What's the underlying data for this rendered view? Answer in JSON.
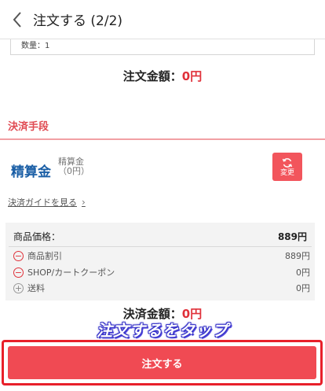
{
  "header": {
    "title": "注文する (2/2)",
    "back_icon": "chevron-left-icon"
  },
  "item": {
    "quantity": "数量：1"
  },
  "order_total": {
    "label": "注文金額：",
    "value": "0円"
  },
  "payment": {
    "section_title": "決済手段",
    "method_name": "精算金",
    "method_sub_line1": "精算金",
    "method_sub_line2": "（0円）",
    "change_label": "変更",
    "change_icon": "refresh-icon",
    "guide_link": "決済ガイドを見る"
  },
  "prices": {
    "main": {
      "label": "商品価格：",
      "value": "889円"
    },
    "rows": [
      {
        "icon": "minus-circle-icon",
        "label": "商品割引",
        "value": "889円"
      },
      {
        "icon": "minus-circle-icon",
        "label": "SHOP/カートクーポン",
        "value": "0円"
      },
      {
        "icon": "plus-circle-icon",
        "label": "送料",
        "value": "0円"
      }
    ]
  },
  "settlement_total": {
    "label": "決済金額：",
    "value": "0円"
  },
  "annotation": "注文するをタップ",
  "order_button": {
    "label": "注文する"
  },
  "colors": {
    "accent": "#f04a53",
    "price_red": "#e0313a",
    "link_blue": "#1b5fa6",
    "annotation": "#3a36c9"
  }
}
